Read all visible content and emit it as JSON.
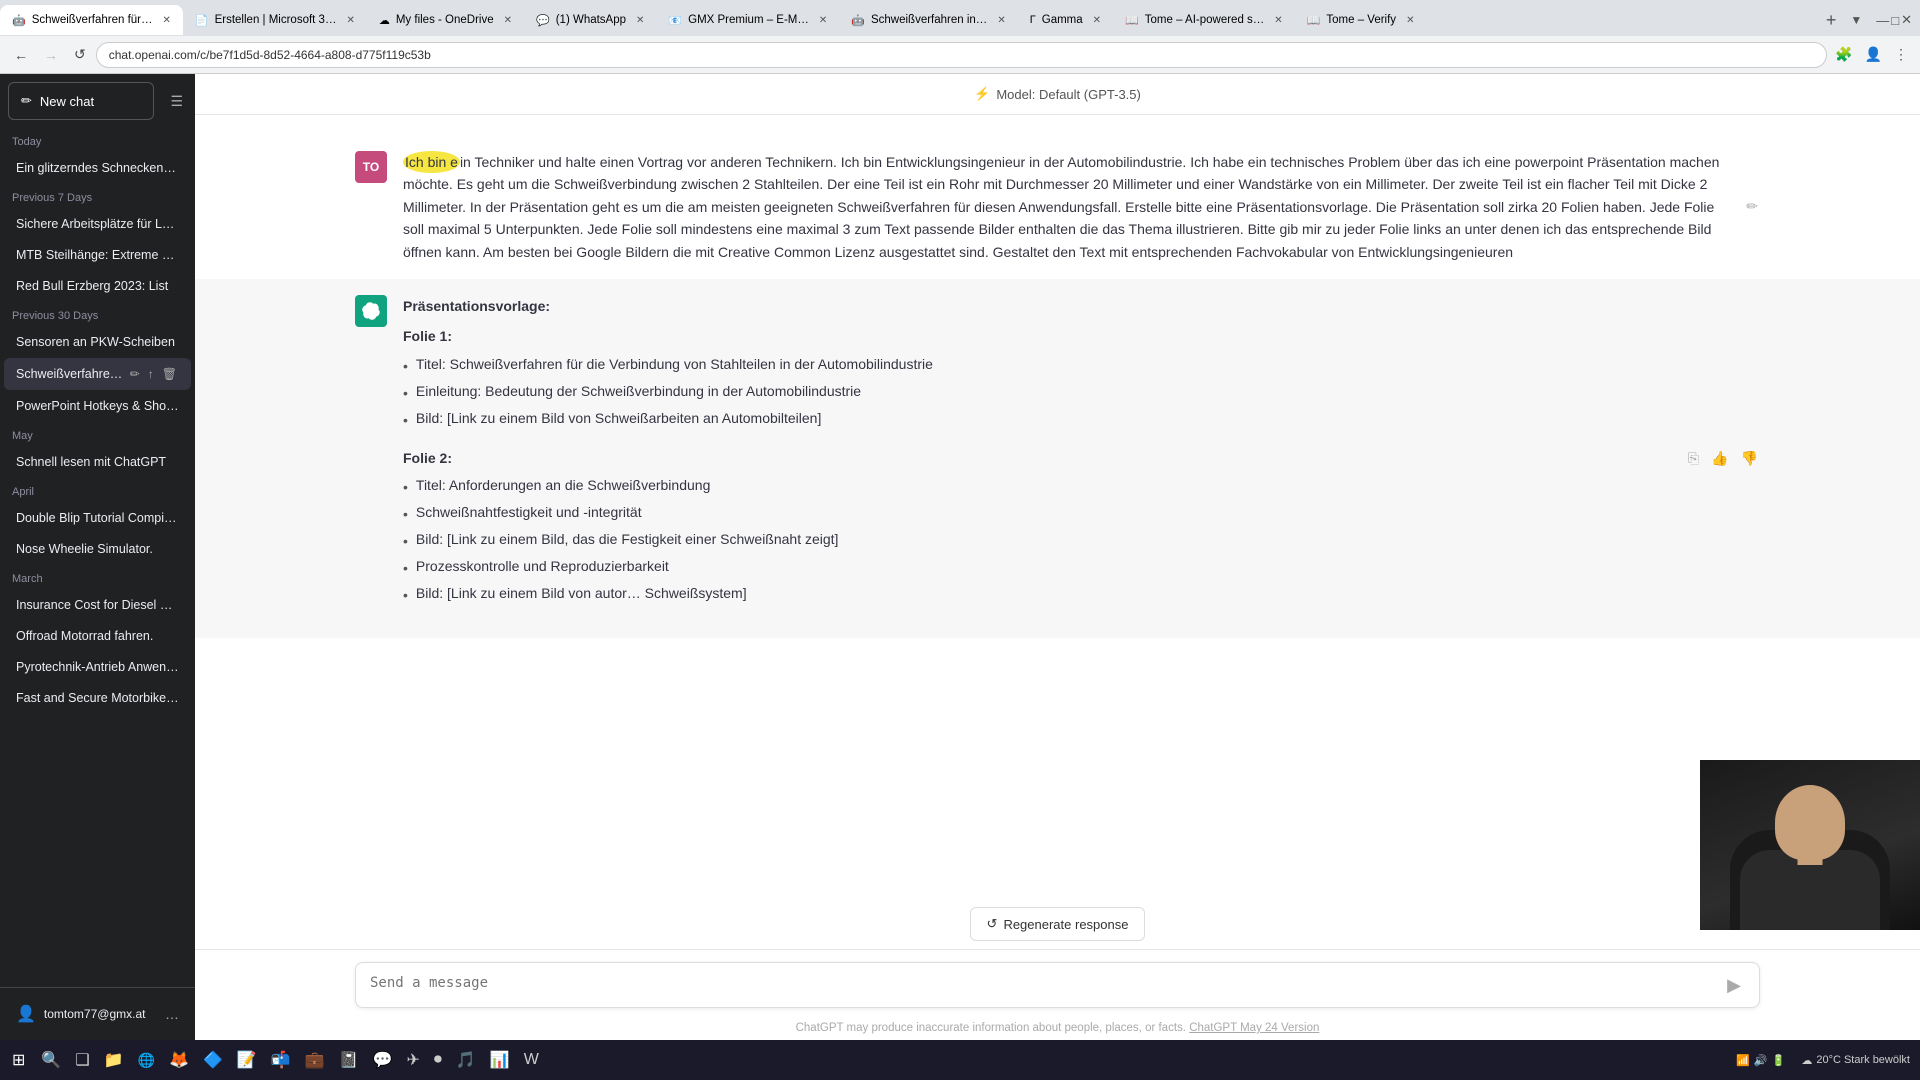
{
  "browser": {
    "tabs": [
      {
        "id": "tab1",
        "label": "Schweißverfahren für…",
        "active": true,
        "favicon": "🤖"
      },
      {
        "id": "tab2",
        "label": "Erstellen | Microsoft 3…",
        "active": false,
        "favicon": "📄"
      },
      {
        "id": "tab3",
        "label": "My files - OneDrive",
        "active": false,
        "favicon": "☁"
      },
      {
        "id": "tab4",
        "label": "(1) WhatsApp",
        "active": false,
        "favicon": "💬"
      },
      {
        "id": "tab5",
        "label": "GMX Premium – E-M…",
        "active": false,
        "favicon": "📧"
      },
      {
        "id": "tab6",
        "label": "Schweißverfahren in…",
        "active": false,
        "favicon": "🤖"
      },
      {
        "id": "tab7",
        "label": "Gamma",
        "active": false,
        "favicon": "Γ"
      },
      {
        "id": "tab8",
        "label": "Tome – AI-powered s…",
        "active": false,
        "favicon": "📖"
      },
      {
        "id": "tab9",
        "label": "Tome – Verify",
        "active": false,
        "favicon": "📖"
      }
    ],
    "address": "chat.openai.com/c/be7f1d5d-8d52-4664-a808-d775f119c53b"
  },
  "model_header": {
    "icon": "⚡",
    "text": "Model: Default (GPT-3.5)"
  },
  "sidebar": {
    "new_chat_label": "New chat",
    "sections": [
      {
        "label": "Today",
        "items": [
          {
            "text": "Ein glitzerndes Schnecken-Ab…",
            "active": false
          }
        ]
      },
      {
        "label": "Previous 7 Days",
        "items": [
          {
            "text": "Sichere Arbeitsplätze für LKW…",
            "active": false
          },
          {
            "text": "MTB Steilhänge: Extreme Fah…",
            "active": false
          },
          {
            "text": "Red Bull Erzberg 2023: List",
            "active": false
          }
        ]
      },
      {
        "label": "Previous 30 Days",
        "items": [
          {
            "text": "Sensoren an PKW-Scheiben",
            "active": false
          },
          {
            "text": "Schweißverfahren fü…",
            "active": true
          },
          {
            "text": "PowerPoint Hotkeys & Shortc…",
            "active": false
          }
        ]
      },
      {
        "label": "May",
        "items": [
          {
            "text": "Schnell lesen mit ChatGPT",
            "active": false
          }
        ]
      },
      {
        "label": "April",
        "items": [
          {
            "text": "Double Blip Tutorial Compilat…",
            "active": false
          },
          {
            "text": "Nose Wheelie Simulator.",
            "active": false
          }
        ]
      },
      {
        "label": "March",
        "items": [
          {
            "text": "Insurance Cost for Diesel Car",
            "active": false
          },
          {
            "text": "Offroad Motorrad fahren.",
            "active": false
          },
          {
            "text": "Pyrotechnik-Antrieb Anwend…",
            "active": false
          },
          {
            "text": "Fast and Secure Motorbike Lo…",
            "active": false
          }
        ]
      }
    ],
    "user": {
      "email": "tomtom77@gmx.at"
    }
  },
  "chat": {
    "messages": [
      {
        "role": "user",
        "avatar_initials": "TO",
        "text": "Ich bin ein Techniker und halte einen Vortrag vor anderen Technikern. Ich bin Entwicklungsingenieur in der Automobilindustrie. Ich habe ein technisches Problem über das ich eine powerpoint Präsentation machen möchte. Es geht um die Schweißverbindung zwischen 2 Stahlteilen. Der eine Teil ist ein Rohr mit Durchmesser 20 Millimeter und einer Wandstärke von ein Millimeter. Der zweite Teil ist ein flacher Teil mit Dicke 2 Millimeter. In der Präsentation geht es um die am meisten geeigneten Schweißverfahren für diesen Anwendungsfall. Erstelle bitte eine Präsentationsvorlage. Die Präsentation soll zirka 20 Folien haben. Jede Folie soll maximal 5 Unterpunkten. Jede Folie soll mindestens eine maximal 3 zum Text passende Bilder enthalten die das Thema illustrieren. Bitte gib mir zu jeder Folie links an unter denen ich das entsprechende Bild öffnen kann. Am besten bei Google Bildern die mit Creative Common Lizenz ausgestattet sind. Gestaltet den Text mit entsprechenden Fachvokabular von Entwicklungsingenieuren"
      },
      {
        "role": "assistant",
        "title": "Präsentationsvorlage:",
        "slides": [
          {
            "label": "Folie 1:",
            "bullets": [
              "Titel: Schweißverfahren für die Verbindung von Stahlteilen in der Automobilindustrie",
              "Einleitung: Bedeutung der Schweißverbindung in der Automobilindustrie",
              "Bild: [Link zu einem Bild von Schweißarbeiten an Automobilteilen]"
            ]
          },
          {
            "label": "Folie 2:",
            "bullets": [
              "Titel: Anforderungen an die Schweißverbindung",
              "Schweißnahtfestigkeit und -integrität",
              "Bild: [Link zu einem Bild, das die Festigkeit einer Schweißnaht zeigt]",
              "Prozesskontrolle und Reproduzierbarkeit",
              "Bild: [Link zu einem Bild von autor… Schweißsystem]"
            ]
          }
        ]
      }
    ],
    "regenerate_label": "Regenerate response",
    "input_placeholder": "Send a message",
    "disclaimer": "ChatGPT may produce inaccurate information about people, places, or facts.",
    "disclaimer_link": "ChatGPT May 24 Version"
  },
  "taskbar": {
    "weather": "20°C  Stark bewölkt",
    "time": ""
  }
}
